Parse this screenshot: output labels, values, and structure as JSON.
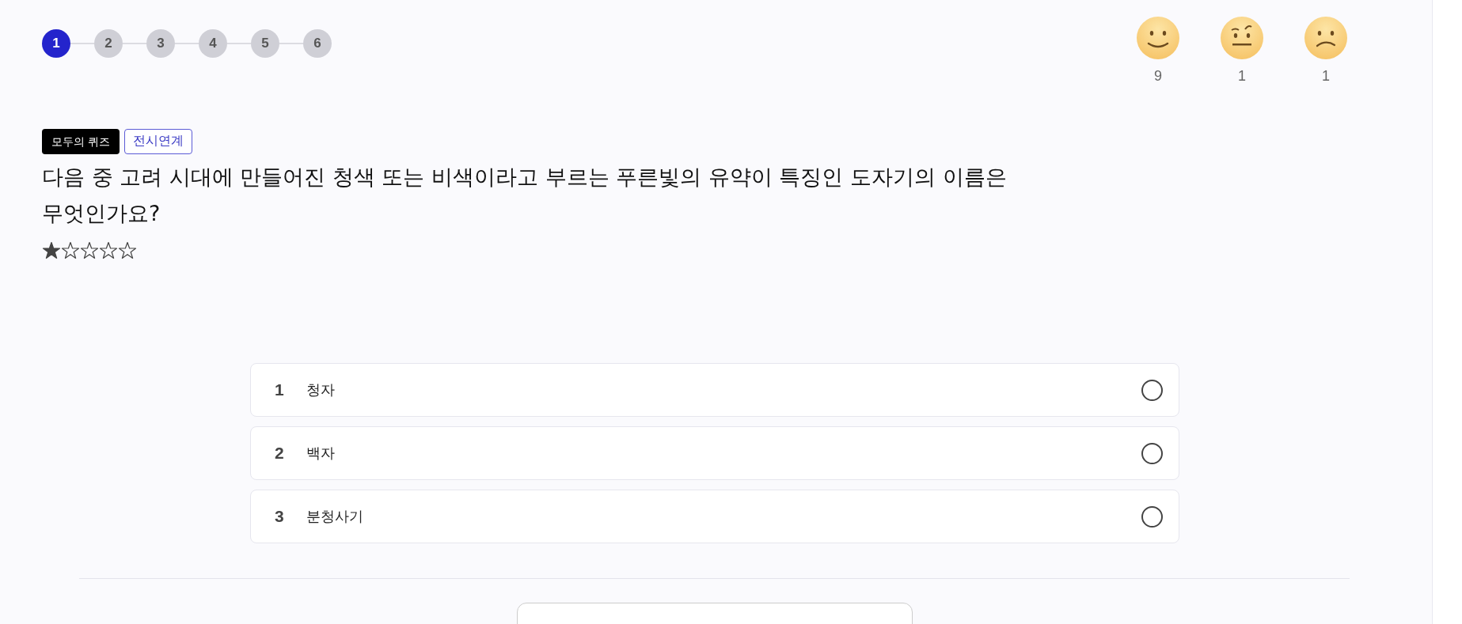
{
  "steps": [
    {
      "label": "1",
      "selected": true
    },
    {
      "label": "2",
      "selected": false
    },
    {
      "label": "3",
      "selected": false
    },
    {
      "label": "4",
      "selected": false
    },
    {
      "label": "5",
      "selected": false
    },
    {
      "label": "6",
      "selected": false
    }
  ],
  "reactions": [
    {
      "kind": "happy",
      "count": "9"
    },
    {
      "kind": "skeptical",
      "count": "1"
    },
    {
      "kind": "sad",
      "count": "1"
    }
  ],
  "tags": [
    {
      "label": "모두의 퀴즈",
      "kind": "filled"
    },
    {
      "label": "전시연계",
      "kind": "outline"
    }
  ],
  "question": "다음 중 고려 시대에 만들어진 청색 또는 비색이라고 부르는 푸른빛의 유약이 특징인 도자기의 이름은 무엇인가요?",
  "difficulty": {
    "stars": 1
  },
  "options": [
    {
      "number": "1",
      "label": "청자",
      "selected": false
    },
    {
      "number": "2",
      "label": "백자",
      "selected": false
    },
    {
      "number": "3",
      "label": "분청사기",
      "selected": false
    }
  ]
}
